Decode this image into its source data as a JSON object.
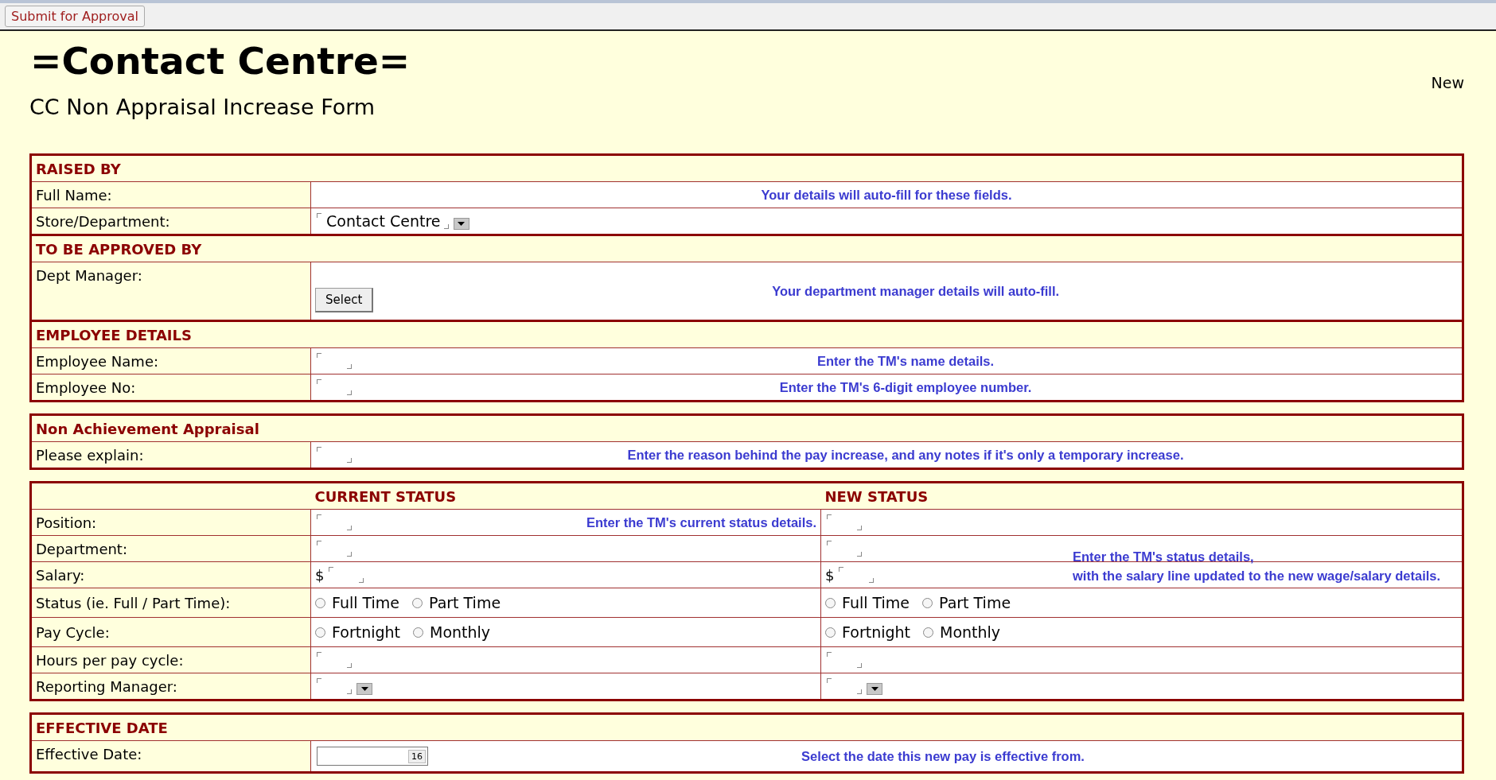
{
  "toolbar": {
    "submit_button": "Submit for Approval"
  },
  "title": "=Contact Centre=",
  "subtitle": "CC Non Appraisal Increase Form",
  "status_label": "New",
  "tables": [
    {
      "rows": [
        {
          "kind": "header",
          "text": "RAISED BY"
        },
        {
          "kind": "plain",
          "label": "Full Name:",
          "hint": "Your details will auto-fill for these fields."
        },
        {
          "kind": "dropdown",
          "label": "Store/Department:",
          "value": "Contact Centre"
        },
        {
          "kind": "header",
          "text": "TO BE APPROVED BY"
        },
        {
          "kind": "button",
          "label": "Dept Manager:",
          "button": "Select",
          "hint": "Your department manager details will auto-fill."
        },
        {
          "kind": "header",
          "text": "EMPLOYEE DETAILS"
        },
        {
          "kind": "field",
          "label": "Employee Name:",
          "hint": "Enter the TM's name details."
        },
        {
          "kind": "field",
          "label": "Employee No:",
          "hint": "Enter the TM's 6-digit employee number."
        }
      ]
    },
    {
      "rows": [
        {
          "kind": "header",
          "text": "Non Achievement Appraisal"
        },
        {
          "kind": "field",
          "label": "Please explain:",
          "hint": "Enter the reason behind the pay increase, and any notes if it's only a temporary increase."
        }
      ]
    }
  ],
  "status_table": {
    "columns": [
      "CURRENT STATUS",
      "NEW STATUS"
    ],
    "new_status_hint": [
      "Enter the TM's status details,",
      "with the salary line updated to the new wage/salary details."
    ],
    "rows": [
      {
        "label": "Position:",
        "kind": "field",
        "current_hint": "Enter the TM's current status details."
      },
      {
        "label": "Department:",
        "kind": "field"
      },
      {
        "label": "Salary:",
        "kind": "money",
        "currency": "$"
      },
      {
        "label": "Status (ie. Full / Part Time):",
        "kind": "radio",
        "current": [
          {
            "label": "Full Time",
            "selected": false
          },
          {
            "label": "Part Time",
            "selected": false
          }
        ],
        "new": [
          {
            "label": "Full Time",
            "selected": false
          },
          {
            "label": "Part Time",
            "selected": false
          }
        ]
      },
      {
        "label": "Pay Cycle:",
        "kind": "radio",
        "current": [
          {
            "label": "Fortnight",
            "selected": false
          },
          {
            "label": "Monthly",
            "selected": false
          }
        ],
        "new": [
          {
            "label": "Fortnight",
            "selected": false
          },
          {
            "label": "Monthly",
            "selected": false
          }
        ]
      },
      {
        "label": "Hours per pay cycle:",
        "kind": "field"
      },
      {
        "label": "Reporting Manager:",
        "kind": "dropdown"
      }
    ]
  },
  "effective": {
    "header": "EFFECTIVE DATE",
    "label": "Effective Date:",
    "calendar_day": "16",
    "hint": "Select the date this new pay is effective from."
  }
}
